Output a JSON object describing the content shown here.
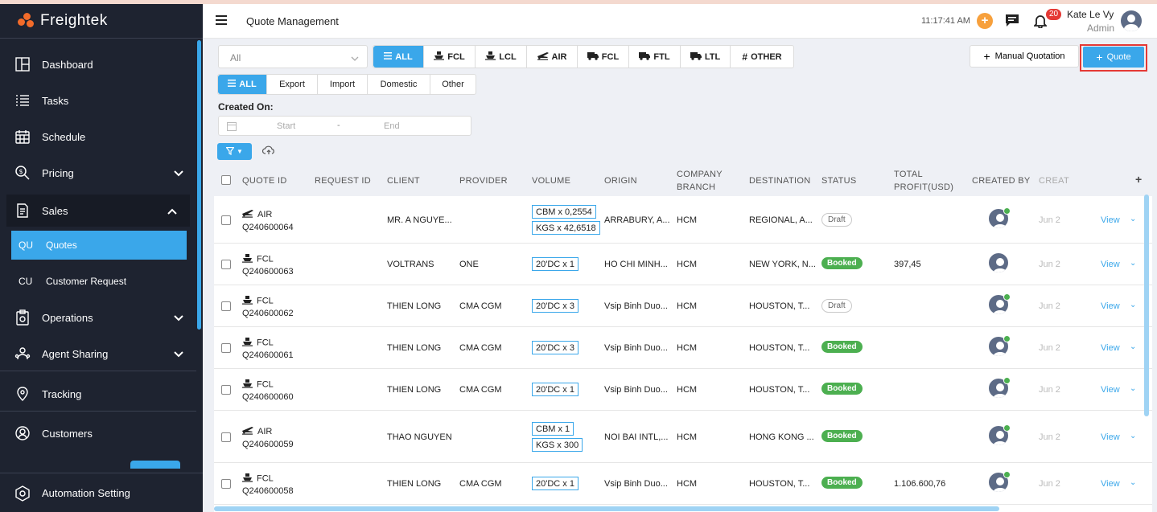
{
  "app": {
    "brand": "Freightek"
  },
  "sidebar": {
    "items": [
      {
        "label": "Dashboard"
      },
      {
        "label": "Tasks"
      },
      {
        "label": "Schedule"
      },
      {
        "label": "Pricing"
      },
      {
        "label": "Sales"
      },
      {
        "label": "Operations"
      },
      {
        "label": "Agent Sharing"
      },
      {
        "label": "Tracking"
      },
      {
        "label": "Customers"
      }
    ],
    "sub_items": [
      {
        "abbr": "QU",
        "label": "Quotes"
      },
      {
        "abbr": "CU",
        "label": "Customer Request"
      }
    ],
    "bottom": {
      "label": "Automation Setting"
    }
  },
  "header": {
    "title": "Quote Management",
    "time": "11:17:41 AM",
    "notification_count": "20",
    "user_name": "Kate Le Vy",
    "user_role": "Admin"
  },
  "filters": {
    "select_value": "All",
    "type_tabs": [
      {
        "label": "ALL",
        "icon": "list-icon"
      },
      {
        "label": "FCL",
        "icon": "ship-icon"
      },
      {
        "label": "LCL",
        "icon": "ship-icon"
      },
      {
        "label": "AIR",
        "icon": "plane-icon"
      },
      {
        "label": "FCL",
        "icon": "truck-icon"
      },
      {
        "label": "FTL",
        "icon": "truck-icon"
      },
      {
        "label": "LTL",
        "icon": "truck-icon"
      },
      {
        "label": "OTHER",
        "icon": "hash-icon"
      }
    ],
    "scope_tabs": [
      "ALL",
      "Export",
      "Import",
      "Domestic",
      "Other"
    ],
    "created_on_label": "Created On:",
    "date_start_placeholder": "Start",
    "date_end_placeholder": "End",
    "date_separator": "-"
  },
  "actions": {
    "manual_label": "Manual Quotation",
    "quote_label": "Quote"
  },
  "table": {
    "columns": {
      "quote_id": "QUOTE ID",
      "request_id": "REQUEST ID",
      "client": "CLIENT",
      "provider": "PROVIDER",
      "volume": "VOLUME",
      "origin": "ORIGIN",
      "company_branch_1": "COMPANY",
      "company_branch_2": "BRANCH",
      "destination": "DESTINATION",
      "status": "STATUS",
      "total_profit_1": "TOTAL",
      "total_profit_2": "PROFIT(USD)",
      "created_by": "CREATED BY",
      "created_at": "CREAT"
    },
    "rows": [
      {
        "type": "AIR",
        "icon": "plane-icon",
        "id": "Q240600064",
        "client": "MR. A NGUYE...",
        "provider": "",
        "volume": [
          "CBM x 0,2554",
          "KGS x 42,6518"
        ],
        "origin": "ARRABURY, A...",
        "branch": "HCM",
        "destination": "REGIONAL, A...",
        "status": "Draft",
        "profit": "",
        "online": true,
        "created_at": "Jun 2",
        "action": "View"
      },
      {
        "type": "FCL",
        "icon": "ship-icon",
        "id": "Q240600063",
        "client": "VOLTRANS",
        "provider": "ONE",
        "volume": [
          "20'DC x 1"
        ],
        "origin": "HO CHI MINH...",
        "branch": "HCM",
        "destination": "NEW YORK, N...",
        "status": "Booked",
        "profit": "397,45",
        "online": false,
        "created_at": "Jun 2",
        "action": "View"
      },
      {
        "type": "FCL",
        "icon": "ship-icon",
        "id": "Q240600062",
        "client": "THIEN LONG",
        "provider": "CMA CGM",
        "volume": [
          "20'DC x 3"
        ],
        "origin": "Vsip Binh Duo...",
        "branch": "HCM",
        "destination": "HOUSTON, T...",
        "status": "Draft",
        "profit": "",
        "online": true,
        "created_at": "Jun 2",
        "action": "View"
      },
      {
        "type": "FCL",
        "icon": "ship-icon",
        "id": "Q240600061",
        "client": "THIEN LONG",
        "provider": "CMA CGM",
        "volume": [
          "20'DC x 3"
        ],
        "origin": "Vsip Binh Duo...",
        "branch": "HCM",
        "destination": "HOUSTON, T...",
        "status": "Booked",
        "profit": "",
        "online": true,
        "created_at": "Jun 2",
        "action": "View"
      },
      {
        "type": "FCL",
        "icon": "ship-icon",
        "id": "Q240600060",
        "client": "THIEN LONG",
        "provider": "CMA CGM",
        "volume": [
          "20'DC x 1"
        ],
        "origin": "Vsip Binh Duo...",
        "branch": "HCM",
        "destination": "HOUSTON, T...",
        "status": "Booked",
        "profit": "",
        "online": true,
        "created_at": "Jun 2",
        "action": "View"
      },
      {
        "type": "AIR",
        "icon": "plane-icon",
        "id": "Q240600059",
        "client": "THAO NGUYEN",
        "provider": "",
        "volume": [
          "CBM x 1",
          "KGS x 300"
        ],
        "origin": "NOI BAI INTL,...",
        "branch": "HCM",
        "destination": "HONG KONG ...",
        "status": "Booked",
        "profit": "",
        "online": true,
        "created_at": "Jun 2",
        "action": "View"
      },
      {
        "type": "FCL",
        "icon": "ship-icon",
        "id": "Q240600058",
        "client": "THIEN LONG",
        "provider": "CMA CGM",
        "volume": [
          "20'DC x 1"
        ],
        "origin": "Vsip Binh Duo...",
        "branch": "HCM",
        "destination": "HOUSTON, T...",
        "status": "Booked",
        "profit": "1.106.600,76",
        "online": true,
        "created_at": "Jun 2",
        "action": "View"
      }
    ]
  },
  "colors": {
    "accent": "#3aa7ea",
    "booked": "#4caf50",
    "sidebar": "#1e2330",
    "highlight": "#e53935",
    "orange": "#f7a03c"
  }
}
